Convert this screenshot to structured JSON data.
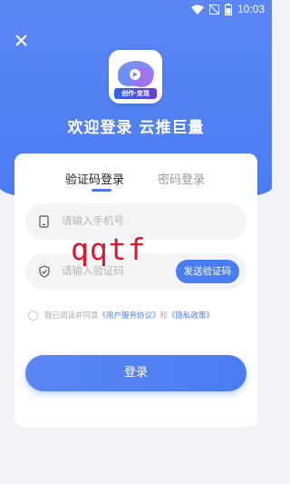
{
  "status": {
    "time": "10:03",
    "battery": "64"
  },
  "logo": {
    "tag": "创作·变现"
  },
  "title": "欢迎登录 云推巨量",
  "tabs": [
    {
      "label": "验证码登录",
      "active": true
    },
    {
      "label": "密码登录",
      "active": false
    }
  ],
  "phone_input": {
    "placeholder": "请输入手机号"
  },
  "code_input": {
    "placeholder": "请输入验证码"
  },
  "send_code_button": "发送验证码",
  "watermark": "qqtf",
  "agreement": {
    "prefix": "我已阅读并同意",
    "user_agreement": "《用户服务协议》",
    "and": "和",
    "privacy_policy": "《隐私政策》"
  },
  "login_button": "登录",
  "colors": {
    "accent": "#4a7cf2",
    "watermark": "#e0142a"
  }
}
